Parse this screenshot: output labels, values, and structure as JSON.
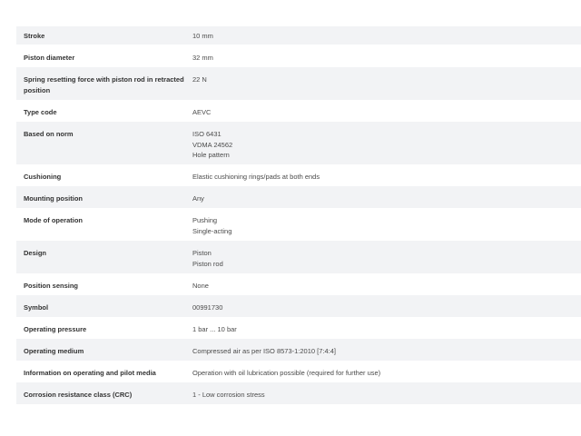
{
  "specs": [
    {
      "label": "Stroke",
      "values": [
        "10 mm"
      ]
    },
    {
      "label": "Piston diameter",
      "values": [
        "32 mm"
      ]
    },
    {
      "label": "Spring resetting force with piston rod in retracted position",
      "values": [
        "22 N"
      ]
    },
    {
      "label": "Type code",
      "values": [
        "AEVC"
      ]
    },
    {
      "label": "Based on norm",
      "values": [
        "ISO 6431",
        "VDMA 24562",
        "Hole pattern"
      ]
    },
    {
      "label": "Cushioning",
      "values": [
        "Elastic cushioning rings/pads at both ends"
      ]
    },
    {
      "label": "Mounting position",
      "values": [
        "Any"
      ]
    },
    {
      "label": "Mode of operation",
      "values": [
        "Pushing",
        "Single-acting"
      ]
    },
    {
      "label": "Design",
      "values": [
        "Piston",
        "Piston rod"
      ]
    },
    {
      "label": "Position sensing",
      "values": [
        "None"
      ]
    },
    {
      "label": "Symbol",
      "values": [
        "00991730"
      ]
    },
    {
      "label": "Operating pressure",
      "values": [
        "1 bar ... 10 bar"
      ]
    },
    {
      "label": "Operating medium",
      "values": [
        "Compressed air as per ISO 8573-1:2010 [7:4:4]"
      ]
    },
    {
      "label": "Information on operating and pilot media",
      "values": [
        "Operation with oil lubrication possible (required for further use)"
      ]
    },
    {
      "label": "Corrosion resistance class (CRC)",
      "values": [
        "1 - Low corrosion stress"
      ]
    }
  ]
}
